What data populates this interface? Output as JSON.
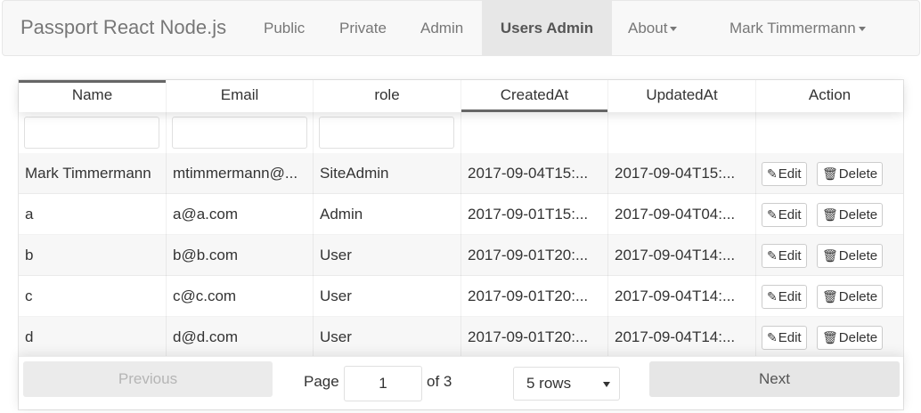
{
  "navbar": {
    "brand": "Passport React Node.js",
    "links": [
      "Public",
      "Private",
      "Admin",
      "Users Admin"
    ],
    "about": "About",
    "user": "Mark Timmermann"
  },
  "table": {
    "columns": [
      "Name",
      "Email",
      "role",
      "CreatedAt",
      "UpdatedAt",
      "Action"
    ],
    "rows": [
      {
        "name": "Mark Timmermann",
        "email": "mtimmermann@...",
        "role": "SiteAdmin",
        "created": "2017-09-04T15:...",
        "updated": "2017-09-04T15:..."
      },
      {
        "name": "a",
        "email": "a@a.com",
        "role": "Admin",
        "created": "2017-09-01T15:...",
        "updated": "2017-09-04T04:..."
      },
      {
        "name": "b",
        "email": "b@b.com",
        "role": "User",
        "created": "2017-09-01T20:...",
        "updated": "2017-09-04T14:..."
      },
      {
        "name": "c",
        "email": "c@c.com",
        "role": "User",
        "created": "2017-09-01T20:...",
        "updated": "2017-09-04T14:..."
      },
      {
        "name": "d",
        "email": "d@d.com",
        "role": "User",
        "created": "2017-09-01T20:...",
        "updated": "2017-09-04T14:..."
      }
    ],
    "edit_label": "Edit",
    "delete_label": "Delete",
    "edit_icon": "pencil-icon",
    "delete_icon": "trash-icon"
  },
  "pagination": {
    "previous": "Previous",
    "next": "Next",
    "page_label": "Page",
    "page_value": "1",
    "of_label": "of 3",
    "rows_selected": "5 rows"
  }
}
